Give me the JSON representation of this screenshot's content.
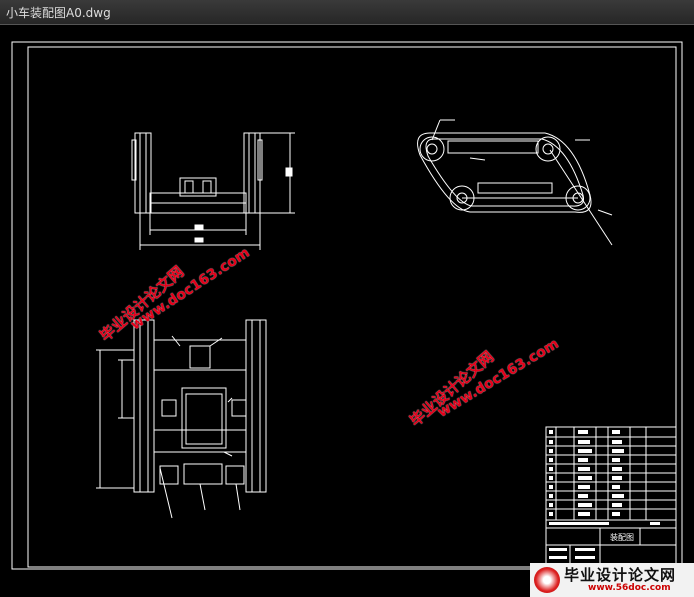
{
  "window": {
    "title": "小车装配图A0.dwg"
  },
  "watermarks": {
    "site_name": "毕业设计论文网",
    "site_url": "www.doc163.com"
  },
  "logo": {
    "name": "毕业设计论文网",
    "url": "www.56doc.com"
  },
  "title_block": {
    "label": "装配图"
  },
  "colors": {
    "background": "#000000",
    "lines": "#ffffff",
    "watermark": "#e4001a"
  }
}
